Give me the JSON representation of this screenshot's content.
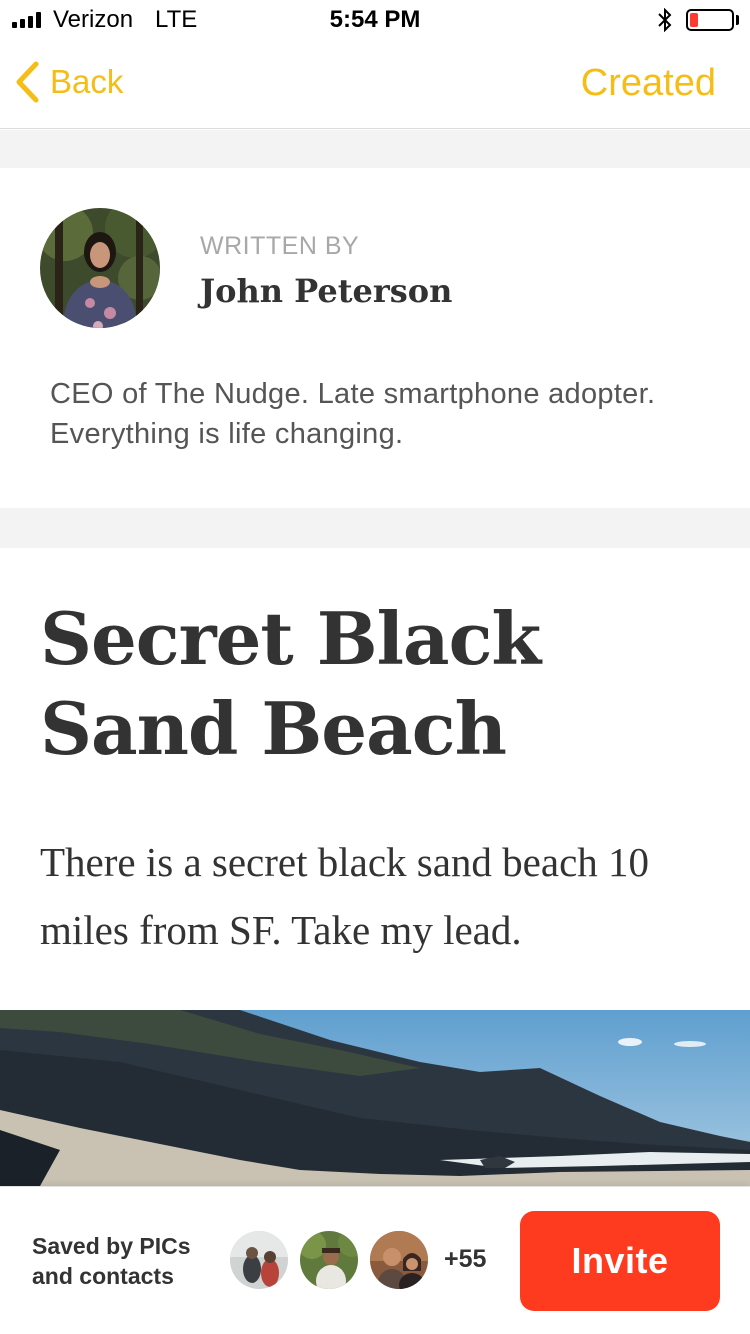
{
  "status_bar": {
    "carrier": "Verizon",
    "network": "LTE",
    "time": "5:54 PM",
    "battery_level": 0.2,
    "battery_color": "#ff3b30"
  },
  "nav": {
    "back_label": "Back",
    "created_label": "Created",
    "accent_color": "#f6bd16"
  },
  "author": {
    "written_by_label": "WRITTEN BY",
    "name": "John Peterson",
    "bio": "CEO of The Nudge. Late smartphone adopter. Everything is life changing."
  },
  "article": {
    "title_line1": "Secret Black",
    "title_line2": "Sand Beach",
    "lead": "There is a secret black sand beach 10 miles from SF. Take my lead."
  },
  "footer": {
    "saved_by_line1": "Saved by PICs",
    "saved_by_line2": "and contacts",
    "more_count": "+55",
    "invite_label": "Invite",
    "invite_color": "#ff3b1f"
  }
}
